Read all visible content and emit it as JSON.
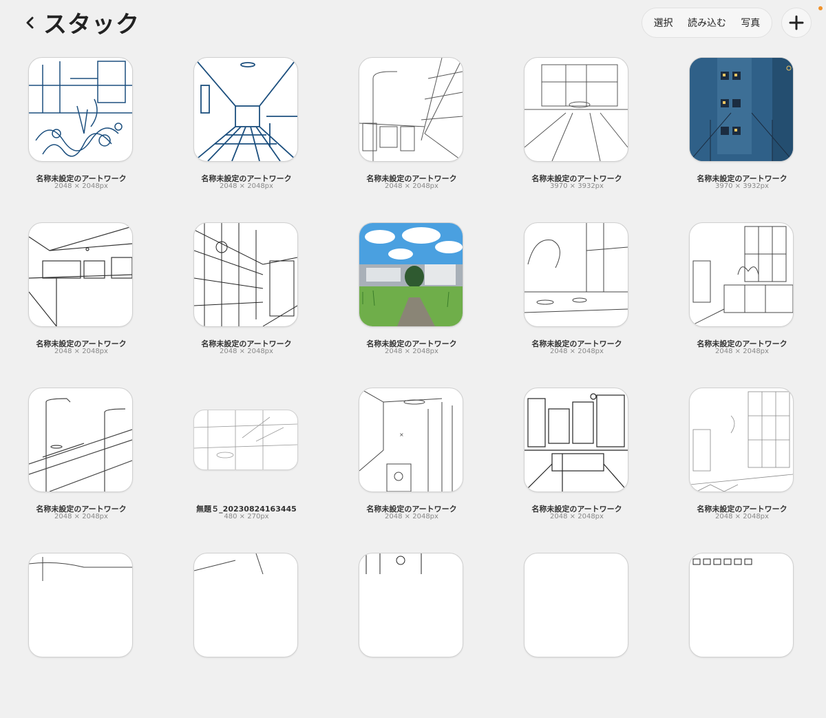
{
  "header": {
    "title": "スタック",
    "actions": {
      "select": "選択",
      "import": "読み込む",
      "photo": "写真"
    }
  },
  "colors": {
    "accent": "#f0922b",
    "ink_blue": "#1c4f7e",
    "night_blue": "#2f6088"
  },
  "items": [
    {
      "title": "名称未設定のアートワーク",
      "size": "2048 × 2048px"
    },
    {
      "title": "名称未設定のアートワーク",
      "size": "2048 × 2048px"
    },
    {
      "title": "名称未設定のアートワーク",
      "size": "2048 × 2048px"
    },
    {
      "title": "名称未設定のアートワーク",
      "size": "3970 × 3932px"
    },
    {
      "title": "名称未設定のアートワーク",
      "size": "3970 × 3932px"
    },
    {
      "title": "名称未設定のアートワーク",
      "size": "2048 × 2048px"
    },
    {
      "title": "名称未設定のアートワーク",
      "size": "2048 × 2048px"
    },
    {
      "title": "名称未設定のアートワーク",
      "size": "2048 × 2048px"
    },
    {
      "title": "名称未設定のアートワーク",
      "size": "2048 × 2048px"
    },
    {
      "title": "名称未設定のアートワーク",
      "size": "2048 × 2048px"
    },
    {
      "title": "名称未設定のアートワーク",
      "size": "2048 × 2048px"
    },
    {
      "title": "無題５_20230824163445",
      "size": "480 × 270px"
    },
    {
      "title": "名称未設定のアートワーク",
      "size": "2048 × 2048px"
    },
    {
      "title": "名称未設定のアートワーク",
      "size": "2048 × 2048px"
    },
    {
      "title": "名称未設定のアートワーク",
      "size": "2048 × 2048px"
    }
  ]
}
